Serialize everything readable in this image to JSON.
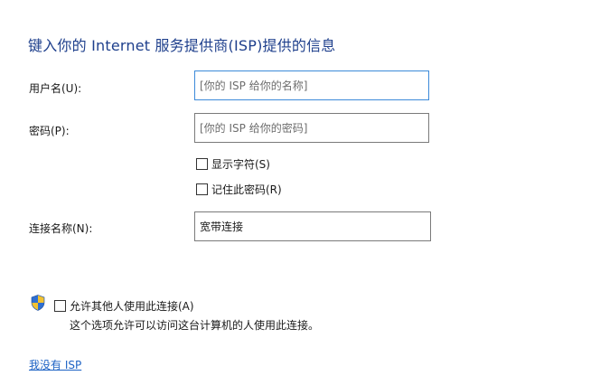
{
  "dialog": {
    "title": "键入你的 Internet 服务提供商(ISP)提供的信息",
    "username": {
      "label": "用户名(U):",
      "placeholder": "[你的 ISP 给你的名称]"
    },
    "password": {
      "label": "密码(P):",
      "placeholder": "[你的 ISP 给你的密码]"
    },
    "show_chars": {
      "label": "显示字符(S)",
      "checked": false
    },
    "remember_password": {
      "label": "记住此密码(R)",
      "checked": false
    },
    "connection_name": {
      "label": "连接名称(N):",
      "value": "宽带连接"
    },
    "allow_others": {
      "label": "允许其他人使用此连接(A)",
      "checked": false,
      "description": "这个选项允许可以访问这台计算机的人使用此连接。",
      "icon": "uac-shield-icon"
    },
    "no_isp_link": "我没有 ISP"
  },
  "colors": {
    "title": "#1e3f8c",
    "link": "#1c62c4",
    "focus_border": "#3c8ad9",
    "field_border": "#7a7a7a"
  }
}
